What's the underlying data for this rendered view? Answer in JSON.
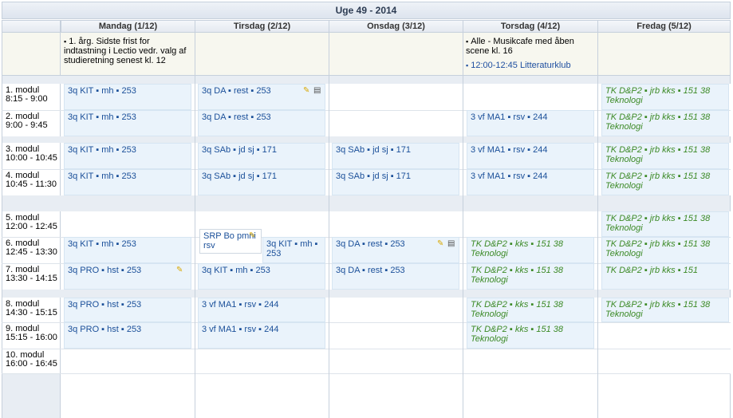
{
  "week_title": "Uge 49 - 2014",
  "days": [
    "Mandag (1/12)",
    "Tirsdag (2/12)",
    "Onsdag (3/12)",
    "Torsdag (4/12)",
    "Fredag (5/12)"
  ],
  "allday": {
    "mon_note": "1. årg. Sidste frist for indtastning i Lectio vedr. valg af studieretning senest kl. 12",
    "thu_note1": "Alle - Musikcafe med åben scene kl. 16",
    "thu_note2": "12:00-12:45 Litteraturklub",
    "bullet": "▪"
  },
  "modules": [
    {
      "name": "1. modul",
      "time": "8:15 - 9:00"
    },
    {
      "name": "2. modul",
      "time": "9:00 - 9:45"
    },
    {
      "name": "3. modul",
      "time": "10:00 - 10:45"
    },
    {
      "name": "4. modul",
      "time": "10:45 - 11:30"
    },
    {
      "name": "5. modul",
      "time": "12:00 - 12:45"
    },
    {
      "name": "6. modul",
      "time": "12:45 - 13:30"
    },
    {
      "name": "7. modul",
      "time": "13:30 - 14:15"
    },
    {
      "name": "8. modul",
      "time": "14:30 - 15:15"
    },
    {
      "name": "9. modul",
      "time": "15:15 - 16:00"
    },
    {
      "name": "10. modul",
      "time": "16:00 - 16:45"
    }
  ],
  "lessons": {
    "mon": [
      "3q KIT ▪ mh ▪ 253",
      "3q KIT ▪ mh ▪ 253",
      "3q KIT ▪ mh ▪ 253",
      "3q KIT ▪ mh ▪ 253",
      "3q KIT ▪ mh ▪ 253",
      "3q PRO ▪ hst ▪ 253",
      "3q PRO ▪ hst ▪ 253",
      "3q PRO ▪ hst ▪ 253"
    ],
    "tue": [
      "3q DA ▪ rest ▪ 253",
      "3q DA ▪ rest ▪ 253",
      "3q SAb ▪ jd sj ▪ 171",
      "3q SAb ▪ jd sj ▪ 171",
      "SRP Bo pmni rsv",
      "3q KIT ▪ mh ▪ 253",
      "3q KIT ▪ mh ▪ 253",
      "3 vf MA1 ▪ rsv ▪ 244",
      "3 vf MA1 ▪ rsv ▪ 244"
    ],
    "wed": [
      "3q SAb ▪ jd sj ▪ 171",
      "3q SAb ▪ jd sj ▪ 171",
      "3q DA ▪ rest ▪ 253",
      "3q DA ▪ rest ▪ 253"
    ],
    "thu": [
      "3 vf MA1 ▪ rsv ▪ 244",
      "3 vf MA1 ▪ rsv ▪ 244",
      "3 vf MA1 ▪ rsv ▪ 244"
    ],
    "thu_it": [
      "TK D&P2 ▪ kks ▪ 151 38 Teknologi",
      "TK D&P2 ▪ kks ▪ 151 38 Teknologi",
      "TK D&P2 ▪ kks ▪ 151 38 Teknologi",
      "TK D&P2 ▪ kks ▪ 151 38 Teknologi"
    ],
    "fri": [
      "TK D&P2 ▪ jrb kks ▪ 151 38 Teknologi",
      "TK D&P2 ▪ jrb kks ▪ 151 38 Teknologi",
      "TK D&P2 ▪ jrb kks ▪ 151 38 Teknologi",
      "TK D&P2 ▪ jrb kks ▪ 151 38 Teknologi",
      "TK D&P2 ▪ jrb kks ▪ 151 38 Teknologi",
      "TK D&P2 ▪ jrb kks ▪ 151 38 Teknologi",
      "TK D&P2 ▪ jrb kks ▪ 151",
      "TK D&P2 ▪ jrb kks ▪ 151 38 Teknologi"
    ]
  },
  "icons": {
    "note": "note-icon",
    "doc": "document-icon"
  },
  "colors": {
    "lesson_bg": "#eaf3fb",
    "lesson_text": "#1a4f99",
    "tk_text": "#3c8a26"
  }
}
